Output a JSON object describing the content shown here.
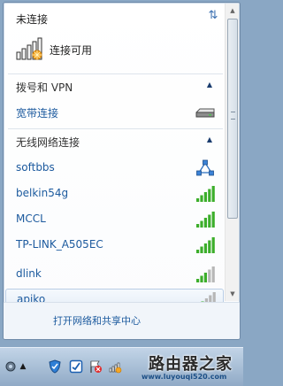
{
  "status": {
    "title": "未连接",
    "connection_text": "连接可用"
  },
  "sections": {
    "dialup": {
      "title": "拨号和 VPN",
      "items": [
        {
          "name": "宽带连接",
          "icon": "modem-icon"
        }
      ]
    },
    "wireless": {
      "title": "无线网络连接"
    }
  },
  "networks": [
    {
      "name": "softbbs",
      "icon": "adhoc-network-icon",
      "signal_bars": null
    },
    {
      "name": "belkin54g",
      "icon": "wifi-signal-icon",
      "signal_bars": 5
    },
    {
      "name": "MCCL",
      "icon": "wifi-signal-icon",
      "signal_bars": 5
    },
    {
      "name": "TP-LINK_A505EC",
      "icon": "wifi-signal-icon",
      "signal_bars": 5
    },
    {
      "name": "dlink",
      "icon": "wifi-signal-icon",
      "signal_bars": 3
    },
    {
      "name": "apiko",
      "icon": "wifi-signal-icon",
      "signal_bars": 2
    }
  ],
  "footer": {
    "link": "打开网络和共享中心"
  },
  "watermark": {
    "name": "路由器之家",
    "url": "www.luyouqi520.com"
  },
  "colors": {
    "link": "#1c5a9e",
    "signal_green": "#3cae2b",
    "signal_gray": "#b7b7b7"
  }
}
